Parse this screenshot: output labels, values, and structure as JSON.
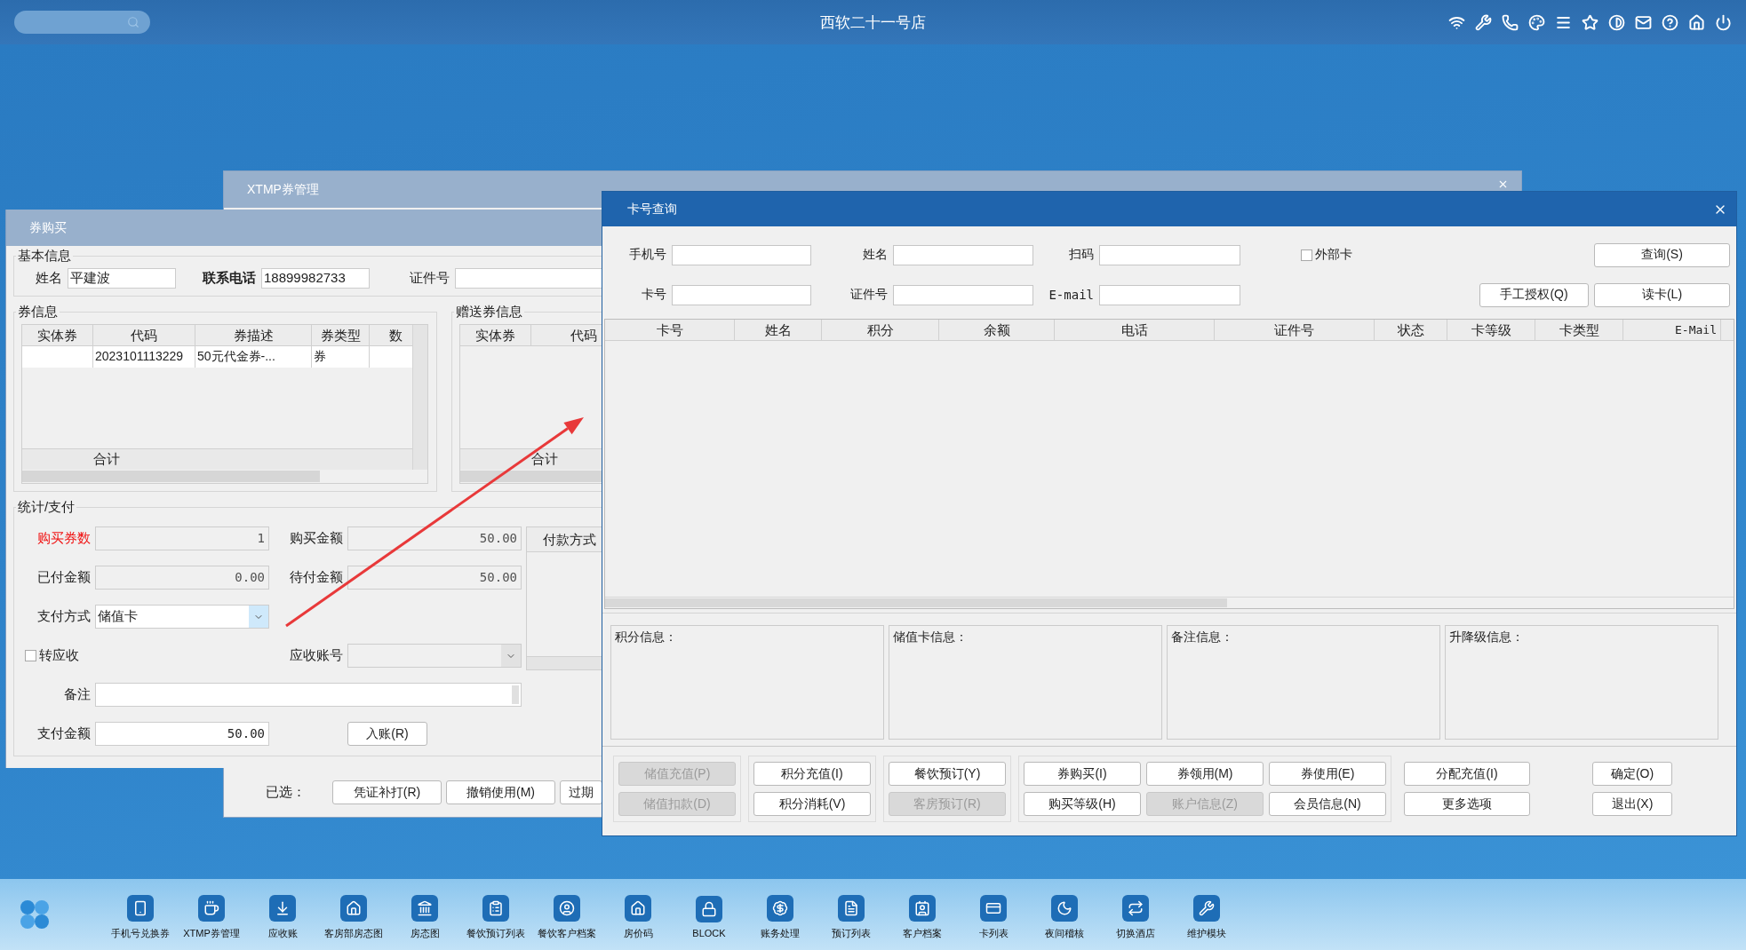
{
  "top_bar": {
    "title": "西软二十一号店"
  },
  "xtmp_window": {
    "title": "XTMP券管理",
    "selected_label": "已选：",
    "buttons": [
      "凭证补打(R)",
      "撤销使用(M)",
      "过期"
    ]
  },
  "purchase_window": {
    "title": "券购买",
    "basic_info": {
      "legend": "基本信息",
      "fields": [
        {
          "label": "姓名",
          "value": "平建波",
          "bold": false
        },
        {
          "label": "联系电话",
          "value": "18899982733",
          "bold": true
        },
        {
          "label": "证件号",
          "bold": false
        }
      ]
    },
    "coupon_info": {
      "legend": "券信息",
      "columns": [
        "实体券",
        "代码",
        "券描述",
        "券类型",
        "数"
      ],
      "rows": [
        {
          "code": "2023101113229",
          "description": "50元代金券-...",
          "type": "券"
        }
      ],
      "total_label": "合计"
    },
    "gift_info": {
      "legend": "赠送券信息",
      "columns": [
        "实体券",
        "代码"
      ],
      "total_label": "合计"
    },
    "payment": {
      "legend": "统计/支付",
      "quantity": {
        "label": "购买券数",
        "value": "1",
        "highlight": true
      },
      "amount": {
        "label": "购买金额",
        "value": "50.00",
        "highlight": false
      },
      "paid": {
        "label": "已付金额",
        "value": "0.00",
        "highlight": false
      },
      "pending": {
        "label": "待付金额",
        "value": "50.00",
        "highlight": false
      },
      "method": {
        "label": "支付方式",
        "value": "储值卡"
      },
      "to_receivable": {
        "label": "转应收",
        "checked": false
      },
      "receivable_account": {
        "label": "应收账号",
        "disabled": true
      },
      "remark": {
        "label": "备注"
      },
      "pay_amount": {
        "label": "支付金额",
        "value": "50.00"
      },
      "post_button": "入账(R)",
      "methods_panel": {
        "header": "付款方式"
      }
    }
  },
  "card_query": {
    "title": "卡号查询",
    "fields": [
      {
        "label": "手机号"
      },
      {
        "label": "姓名"
      },
      {
        "label": "扫码"
      },
      {
        "label": "卡号"
      },
      {
        "label": "证件号"
      },
      {
        "label": "E-mail"
      }
    ],
    "external_card": {
      "label": "外部卡",
      "checked": false
    },
    "query_button": "查询(S)",
    "auth_button": "手工授权(Q)",
    "read_button": "读卡(L)",
    "table": {
      "columns": [
        "卡号",
        "姓名",
        "积分",
        "余额",
        "电话",
        "证件号",
        "状态",
        "卡等级",
        "卡类型",
        "E-Mail"
      ]
    },
    "info_panels": [
      "积分信息：",
      "储值卡信息：",
      "备注信息：",
      "升降级信息："
    ],
    "action_groups": [
      {
        "kind": "framed",
        "rows": [
          [
            {
              "label": "储值充值(P)",
              "disabled": true
            }
          ],
          [
            {
              "label": "储值扣款(D)",
              "disabled": true
            }
          ]
        ]
      },
      {
        "kind": "framed",
        "rows": [
          [
            {
              "label": "积分充值(I)",
              "disabled": false
            }
          ],
          [
            {
              "label": "积分消耗(V)",
              "disabled": false
            }
          ]
        ]
      },
      {
        "kind": "framed",
        "rows": [
          [
            {
              "label": "餐饮预订(Y)",
              "disabled": false
            }
          ],
          [
            {
              "label": "客房预订(R)",
              "disabled": true
            }
          ]
        ]
      },
      {
        "kind": "framed",
        "rows": [
          [
            {
              "label": "券购买(I)",
              "disabled": false
            },
            {
              "label": "券领用(M)",
              "disabled": false
            },
            {
              "label": "券使用(E)",
              "disabled": false
            }
          ],
          [
            {
              "label": "购买等级(H)",
              "disabled": false
            },
            {
              "label": "账户信息(Z)",
              "disabled": true
            },
            {
              "label": "会员信息(N)",
              "disabled": false
            }
          ]
        ]
      },
      {
        "kind": "plain",
        "rows": [
          [
            {
              "label": "分配充值(I)",
              "disabled": false
            }
          ],
          [
            {
              "label": "更多选项",
              "disabled": false
            }
          ]
        ]
      },
      {
        "kind": "dialog",
        "rows": [
          [
            {
              "label": "确定(O)",
              "disabled": false
            }
          ],
          [
            {
              "label": "退出(X)",
              "disabled": false
            }
          ]
        ]
      }
    ]
  },
  "taskbar": {
    "items": [
      "手机号兑换券",
      "XTMP券管理",
      "应收账",
      "客房部房态图",
      "房态图",
      "餐饮预订列表",
      "餐饮客户档案",
      "房价码",
      "BLOCK",
      "账务处理",
      "预订列表",
      "客户档案",
      "卡列表",
      "夜间稽核",
      "切换酒店",
      "维护模块"
    ]
  }
}
